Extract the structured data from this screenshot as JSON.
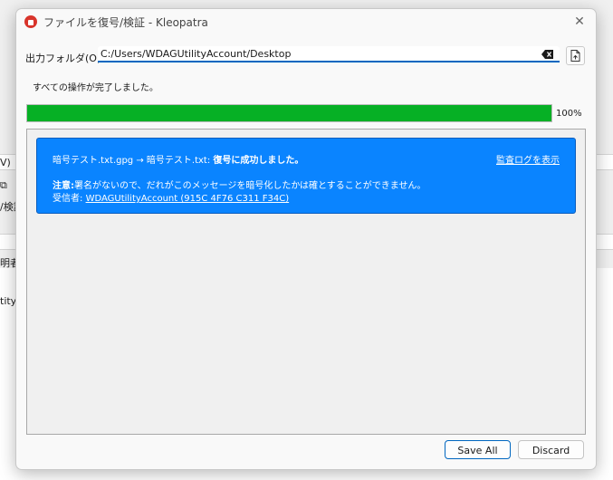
{
  "background_app": {
    "row_texts": [
      "V)",
      "/検証",
      "明者",
      "tityA"
    ]
  },
  "dialog": {
    "title": "ファイルを復号/検証 - Kleopatra",
    "close_glyph": "✕",
    "output_folder": {
      "label": "出力フォルダ(O):",
      "value": "C:/Users/WDAGUtilityAccount/Desktop"
    },
    "status": "すべての操作が完了しました。",
    "progress": {
      "percent": 100,
      "label": "100%"
    },
    "result": {
      "file_flow": "暗号テスト.txt.gpg → 暗号テスト.txt:",
      "success": "復号に成功しました。",
      "audit_link": "監査ログを表示",
      "note_label": "注意:",
      "note_text": "署名がないので、だれがこのメッセージを暗号化したかは確とすることができません。",
      "recipient_label": "受信者:",
      "recipient": "WDAGUtilityAccount (915C 4F76 C311 F34C)"
    },
    "buttons": {
      "save_all": "Save All",
      "discard": "Discard"
    }
  },
  "colors": {
    "accent": "#0067c0",
    "progress": "#06b025",
    "result_box": "#0a84ff"
  }
}
